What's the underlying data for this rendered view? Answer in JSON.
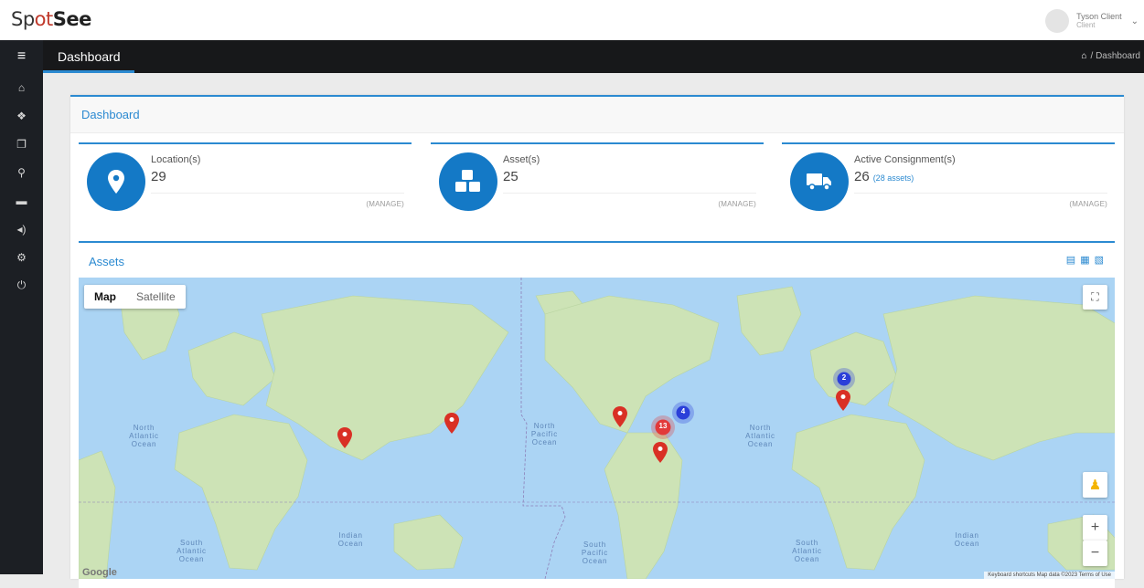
{
  "app": {
    "logo_prefix": "Sp",
    "logo_pin": "ot",
    "logo_suffix": "See"
  },
  "user": {
    "name": "Tyson Client",
    "role": "Client"
  },
  "header": {
    "title": "Dashboard",
    "breadcrumb": "/ Dashboard"
  },
  "sidebar": {
    "items": [
      {
        "icon": "home-icon",
        "glyph": "⌂"
      },
      {
        "icon": "cubes-icon",
        "glyph": "❖"
      },
      {
        "icon": "copy-icon",
        "glyph": "❐"
      },
      {
        "icon": "location-pin-icon",
        "glyph": "⚲"
      },
      {
        "icon": "truck-icon",
        "glyph": "▬"
      },
      {
        "icon": "volume-icon",
        "glyph": "◂)"
      },
      {
        "icon": "cogs-icon",
        "glyph": "⚙"
      },
      {
        "icon": "power-icon",
        "glyph": "⏻"
      }
    ]
  },
  "panel": {
    "title": "Dashboard"
  },
  "stats": [
    {
      "label": "Location(s)",
      "value": "29",
      "sub": "",
      "manage": "(MANAGE)",
      "icon": "map-marker-icon"
    },
    {
      "label": "Asset(s)",
      "value": "25",
      "sub": "",
      "manage": "(MANAGE)",
      "icon": "cubes-icon"
    },
    {
      "label": "Active Consignment(s)",
      "value": "26",
      "sub": "(28 assets)",
      "manage": "(MANAGE)",
      "icon": "truck-icon"
    }
  ],
  "assets": {
    "title": "Assets",
    "export_icons": [
      "csv-icon",
      "excel-icon",
      "pdf-icon"
    ]
  },
  "map": {
    "type_map": "Map",
    "type_satellite": "Satellite",
    "zoom_in": "+",
    "zoom_out": "−",
    "oceans": [
      "North Atlantic Ocean",
      "North Pacific Ocean",
      "North Atlantic Ocean",
      "South Atlantic Ocean",
      "Indian Ocean",
      "South Pacific Ocean",
      "South Atlantic Ocean",
      "Indian Ocean"
    ],
    "clusters": [
      {
        "count": "2",
        "color": "#2b3fd9"
      },
      {
        "count": "4",
        "color": "#2b3fd9"
      },
      {
        "count": "13",
        "color": "#e23a3a"
      }
    ],
    "attribution": "Keyboard shortcuts   Map data ©2023   Terms of Use",
    "google": "Google"
  },
  "colors": {
    "accent": "#2b8ad1",
    "stat_circle": "#1479c6",
    "sidebar": "#1c1f24",
    "marker": "#d93025",
    "water": "#abd4f4",
    "land": "#cde3b6"
  }
}
